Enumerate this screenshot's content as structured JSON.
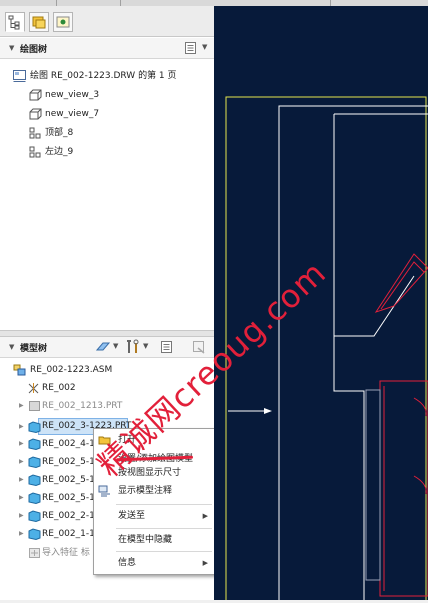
{
  "drawing_tree": {
    "title": "绘图树",
    "root_label": "绘图 RE_002-1223.DRW 的第 1 页",
    "items": [
      {
        "label": "new_view_3"
      },
      {
        "label": "new_view_7"
      },
      {
        "label": "顶部_8"
      },
      {
        "label": "左边_9"
      }
    ]
  },
  "model_tree": {
    "title": "模型树",
    "root_label": "RE_002-1223.ASM",
    "items": [
      {
        "label": "RE_002",
        "state": "normal"
      },
      {
        "label": "RE_002_1213.PRT",
        "state": "suppressed"
      },
      {
        "label": "RE_002_3-1223.PRT",
        "state": "selected"
      },
      {
        "label": "RE_002_4-1",
        "state": "normal"
      },
      {
        "label": "RE_002_5-1",
        "state": "normal"
      },
      {
        "label": "RE_002_5-1",
        "state": "normal"
      },
      {
        "label": "RE_002_5-1",
        "state": "normal"
      },
      {
        "label": "RE_002_2-1",
        "state": "normal"
      },
      {
        "label": "RE_002_1-1",
        "state": "normal"
      },
      {
        "label": "导入特征 标",
        "state": "suppressed"
      }
    ]
  },
  "context_menu": {
    "items": [
      {
        "label": "打开",
        "submenu": false
      },
      {
        "label": "设置/添加绘图模型",
        "submenu": false
      },
      {
        "label": "按视图显示尺寸",
        "submenu": false
      },
      {
        "label": "显示模型注释",
        "submenu": false
      },
      {
        "label": "发送至",
        "submenu": true
      },
      {
        "label": "在模型中隐藏",
        "submenu": false
      },
      {
        "label": "信息",
        "submenu": true
      }
    ]
  },
  "watermark": {
    "text": "精诚网creoug.com"
  },
  "colors": {
    "canvas_bg": "#071a3a",
    "drawing_line": "#ffffff",
    "sheet_border": "#e6e64d",
    "highlight": "#e2203a",
    "selection": "#cde3f7"
  },
  "icons": {
    "tab1": "model-tree-icon",
    "tab2": "folder-browser-icon",
    "tab3": "favorites-icon",
    "drawing_root": "drawing-sheet-icon",
    "view": "view-icon",
    "part": "part-icon",
    "assembly": "assembly-icon",
    "coord": "csys-icon"
  }
}
